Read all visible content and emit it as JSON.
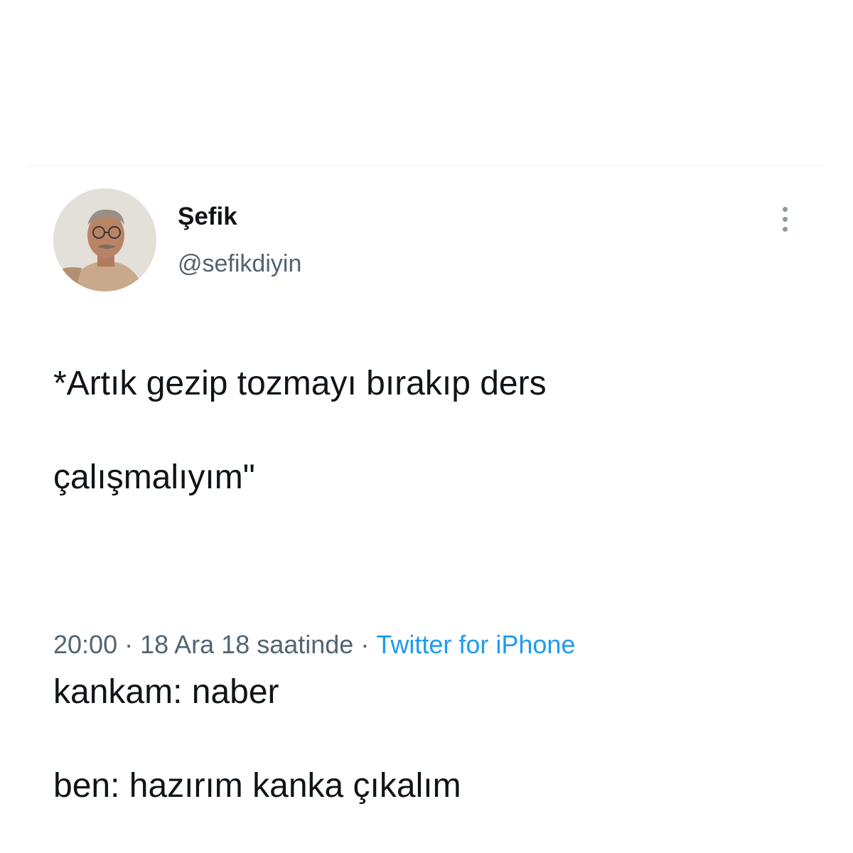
{
  "tweet": {
    "author": {
      "display_name": "Şefik",
      "handle": "@sefikdiyin"
    },
    "text_lines": [
      "*Artık gezip tozmayı bırakıp ders",
      "çalışmalıyım\"",
      "kankam: naber",
      "ben: hazırım kanka çıkalım"
    ],
    "meta": {
      "time": "20:00",
      "separator": "·",
      "date": "18 Ara 18 saatinde",
      "source": "Twitter for iPhone"
    },
    "more_icon": "more-vertical-icon"
  },
  "colors": {
    "text": "#0f1419",
    "secondary": "#536471",
    "link": "#1d9bf0"
  }
}
